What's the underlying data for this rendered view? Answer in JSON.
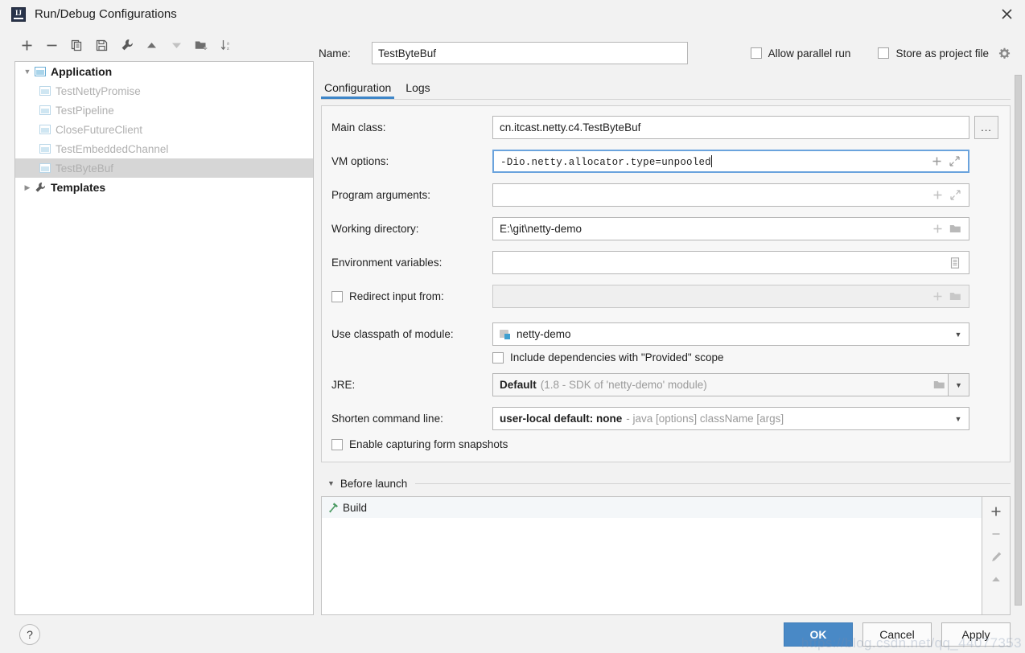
{
  "window": {
    "title": "Run/Debug Configurations",
    "app_icon": "intellij-idea-icon",
    "close_icon": "close-icon"
  },
  "left_panel": {
    "toolbar": [
      {
        "name": "add-configuration-button",
        "icon": "plus-icon",
        "label": "+"
      },
      {
        "name": "remove-configuration-button",
        "icon": "minus-icon",
        "label": "−"
      },
      {
        "name": "copy-configuration-button",
        "icon": "copy-icon",
        "label": "copy"
      },
      {
        "name": "save-configuration-button",
        "icon": "save-icon",
        "label": "save"
      },
      {
        "name": "edit-templates-button",
        "icon": "wrench-icon",
        "label": "wrench"
      },
      {
        "name": "move-up-button",
        "icon": "arrow-up-icon",
        "label": "up"
      },
      {
        "name": "move-down-button",
        "icon": "arrow-down-icon",
        "label": "down"
      },
      {
        "name": "new-folder-button",
        "icon": "new-folder-icon",
        "label": "folder"
      },
      {
        "name": "sort-configurations-button",
        "icon": "sort-alphabetical-icon",
        "label": "sort"
      }
    ],
    "tree": [
      {
        "label": "Application",
        "type": "group",
        "expanded": true,
        "bold": true,
        "selected": false,
        "indent": 0
      },
      {
        "label": "TestNettyPromise",
        "type": "config",
        "bold": false,
        "selected": false,
        "indent": 1
      },
      {
        "label": "TestPipeline",
        "type": "config",
        "bold": false,
        "selected": false,
        "indent": 1
      },
      {
        "label": "CloseFutureClient",
        "type": "config",
        "bold": false,
        "selected": false,
        "indent": 1
      },
      {
        "label": "TestEmbeddedChannel",
        "type": "config",
        "bold": false,
        "selected": false,
        "indent": 1
      },
      {
        "label": "TestByteBuf",
        "type": "config",
        "bold": false,
        "selected": true,
        "indent": 1
      },
      {
        "label": "Templates",
        "type": "templates",
        "expanded": false,
        "bold": true,
        "selected": false,
        "indent": 0
      }
    ]
  },
  "header": {
    "name_label": "Name:",
    "name_value": "TestByteBuf",
    "allow_parallel_run": {
      "label": "Allow parallel run",
      "checked": false
    },
    "store_as_project_file": {
      "label": "Store as project file",
      "checked": false
    },
    "gear_icon": "gear-icon"
  },
  "tabs": [
    {
      "label": "Configuration",
      "active": true
    },
    {
      "label": "Logs",
      "active": false
    }
  ],
  "form": {
    "main_class": {
      "label": "Main class:",
      "value": "cn.itcast.netty.c4.TestByteBuf",
      "browse_label": "..."
    },
    "vm_options": {
      "label": "VM options:",
      "value": "-Dio.netty.allocator.type=unpooled",
      "focused": true,
      "macro_icon": "plus-icon",
      "expand_icon": "expand-diagonal-icon"
    },
    "program_arguments": {
      "label": "Program arguments:",
      "value": "",
      "macro_icon": "plus-icon",
      "expand_icon": "expand-diagonal-icon"
    },
    "working_directory": {
      "label": "Working directory:",
      "value": "E:\\git\\netty-demo",
      "macro_icon": "plus-icon",
      "browse_icon": "folder-icon"
    },
    "environment_variables": {
      "label": "Environment variables:",
      "value": "",
      "browse_icon": "list-editor-icon"
    },
    "redirect_input": {
      "label": "Redirect input from:",
      "checked": false,
      "value": "",
      "macro_icon": "plus-icon",
      "browse_icon": "folder-icon"
    },
    "use_classpath_of_module": {
      "label": "Use classpath of module:",
      "value": "netty-demo",
      "module_icon": "module-icon",
      "dropdown_icon": "chevron-down-icon"
    },
    "include_provided_scope": {
      "label": "Include dependencies with \"Provided\" scope",
      "checked": false
    },
    "jre": {
      "label": "JRE:",
      "value_bold": "Default",
      "value_gray": "(1.8 - SDK of 'netty-demo' module)",
      "browse_icon": "folder-icon",
      "dropdown_icon": "chevron-down-icon"
    },
    "shorten_command_line": {
      "label": "Shorten command line:",
      "value_bold": "user-local default: none",
      "value_gray": "- java [options] className [args]",
      "dropdown_icon": "chevron-down-icon"
    },
    "enable_form_snapshots": {
      "label": "Enable capturing form snapshots",
      "checked": false
    }
  },
  "before_launch": {
    "title": "Before launch",
    "expanded": true,
    "items": [
      {
        "label": "Build",
        "icon": "hammer-icon"
      }
    ],
    "toolbar": [
      {
        "name": "add-before-launch-task-button",
        "icon": "plus-icon"
      },
      {
        "name": "remove-before-launch-task-button",
        "icon": "minus-icon"
      },
      {
        "name": "edit-before-launch-task-button",
        "icon": "pencil-icon"
      },
      {
        "name": "move-task-up-button",
        "icon": "arrow-up-icon"
      }
    ]
  },
  "footer": {
    "help_label": "?",
    "ok_label": "OK",
    "cancel_label": "Cancel",
    "apply_label": "Apply",
    "watermark": "https://blog.csdn.net/qq_44077353"
  },
  "colors": {
    "accent": "#4989c6",
    "tab_underline": "#3e86c8",
    "selection": "#d6d6d6",
    "focus_border": "#6aa3dd"
  }
}
